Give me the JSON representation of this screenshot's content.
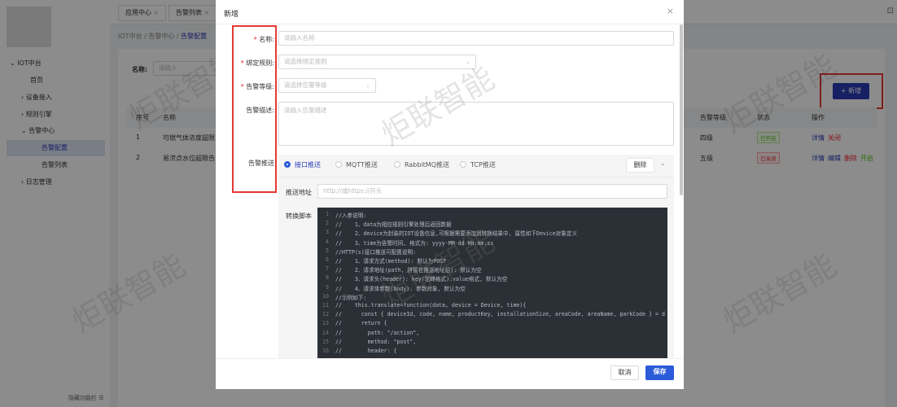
{
  "sidebar": {
    "items": [
      {
        "label": "IOT中台",
        "arrow": "⌄"
      },
      {
        "label": "首页",
        "arrow": ""
      },
      {
        "label": "设备接入",
        "arrow": "›"
      },
      {
        "label": "规则引擎",
        "arrow": "›"
      },
      {
        "label": "告警中心",
        "arrow": "⌄"
      },
      {
        "label": "告警配置",
        "arrow": ""
      },
      {
        "label": "告警列表",
        "arrow": ""
      },
      {
        "label": "日志管理",
        "arrow": "›"
      }
    ],
    "hide_label": "隐藏功能栏 ☰"
  },
  "tabs": [
    {
      "label": "应用中心"
    },
    {
      "label": "告警列表"
    }
  ],
  "breadcrumb": [
    "IOT中台",
    "告警中心",
    "告警配置"
  ],
  "filter": {
    "label": "名称:",
    "placeholder": "请输入"
  },
  "add_button": "+ 新增",
  "table": {
    "headers": [
      "序号",
      "名称",
      "告警等级",
      "状态",
      "操作"
    ],
    "rows": [
      {
        "index": "1",
        "name": "可燃气体浓度超限",
        "level": "四级",
        "status": "已开启",
        "actions": [
          "详情",
          "关闭"
        ]
      },
      {
        "index": "2",
        "name": "易涝点水位超限告",
        "level": "五级",
        "status": "已关闭",
        "actions": [
          "详情",
          "编辑",
          "删除",
          "开启"
        ]
      }
    ]
  },
  "modal": {
    "title": "新增",
    "close": "×",
    "fields": {
      "name": {
        "label": "名称:",
        "placeholder": "请输入名称"
      },
      "rule": {
        "label": "绑定规则:",
        "placeholder": "请选择绑定规则"
      },
      "level": {
        "label": "告警等级:",
        "placeholder": "请选择告警等级"
      },
      "desc": {
        "label": "告警描述:",
        "placeholder": "请输入告警描述"
      },
      "push": {
        "label": "告警推送"
      }
    },
    "push": {
      "options": [
        "接口推送",
        "MQTT推送",
        "RabbitMQ推送",
        "TCP推送"
      ],
      "selected": "接口推送",
      "delete": "删除",
      "url_label": "推送地址",
      "url_placeholder": "http://或https://开头",
      "script_label": "转换脚本",
      "code": [
        "//入参说明:",
        "//    1、data为相应规则引擎处理后返回数据",
        "//    2、device为封装的IOT设备信息,可根据需要添加到转换结果中, 属性如下Device对象定义",
        "//    3、time为告警时间, 格式为: yyyy-MM-dd HH:mm:ss",
        "//HTTP(s)接口推送可配置说明:",
        "//    1、请求方式(method): 默认为POST",
        "//    2、请求地址(path, 拼接在推送地址后): 默认为空",
        "//    3、请求头(header): key(驼峰格式):value格式, 默认为空",
        "//    4、请求体参数(body): 参数对象, 默认为空",
        "//示例如下:",
        "//    this.translate=function(data, device = Device, time){",
        "//      const { deviceId, code, name, productKey, installationSize, areaCode, areaName, parkCode } = d",
        "//      return {",
        "//        path: \"/action\",",
        "//        method: \"post\",",
        "//        header: {"
      ]
    },
    "cancel": "取消",
    "save": "保存"
  },
  "watermark": "炬联智能",
  "colors": {
    "primary": "#2b3bb5",
    "danger": "#f5222d",
    "success": "#52c41a",
    "highlight": "#e53935"
  }
}
